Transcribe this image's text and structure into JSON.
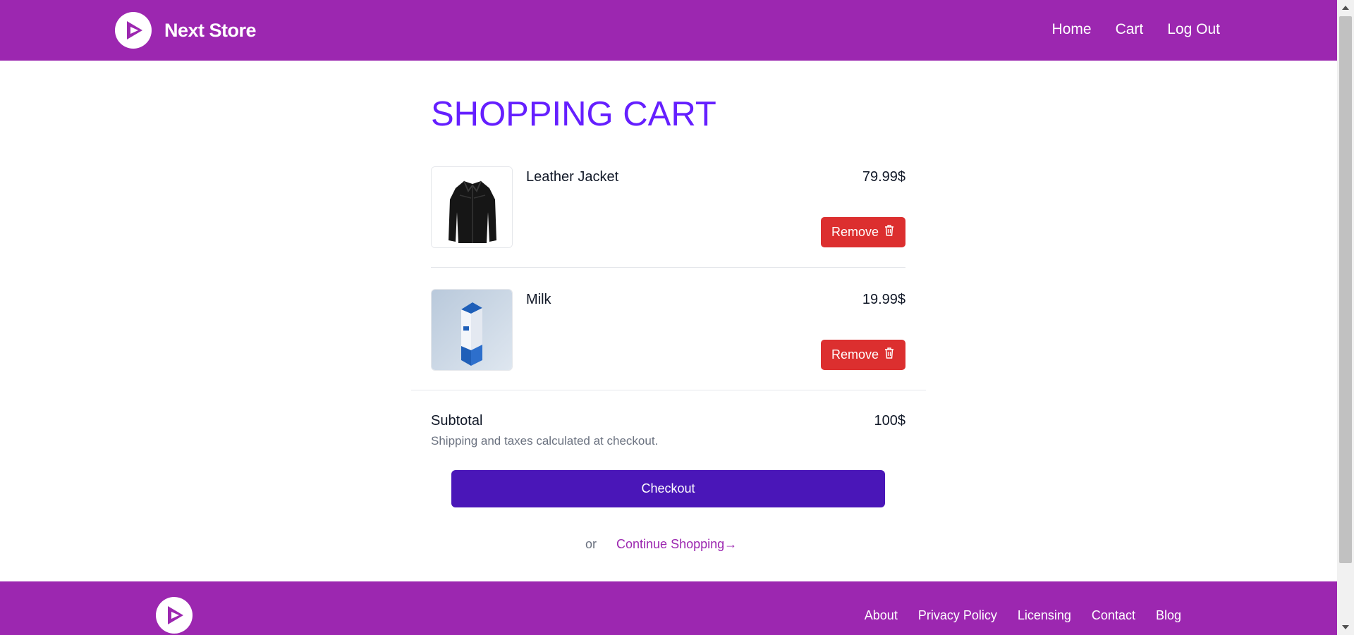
{
  "header": {
    "brand_name": "Next Store",
    "nav": [
      "Home",
      "Cart",
      "Log Out"
    ]
  },
  "page": {
    "title": "SHOPPING CART"
  },
  "cart": {
    "items": [
      {
        "name": "Leather Jacket",
        "price": "79.99$",
        "remove_label": "Remove",
        "image_icon": "leather-jacket-image"
      },
      {
        "name": "Milk",
        "price": "19.99$",
        "remove_label": "Remove",
        "image_icon": "milk-carton-image"
      }
    ],
    "subtotal_label": "Subtotal",
    "subtotal_value": "100$",
    "shipping_note": "Shipping and taxes calculated at checkout.",
    "checkout_label": "Checkout",
    "or_text": "or",
    "continue_label": "Continue Shopping→"
  },
  "footer": {
    "links": [
      "About",
      "Privacy Policy",
      "Licensing",
      "Contact",
      "Blog"
    ]
  },
  "colors": {
    "brand": "#9c27b0",
    "title": "#651fff",
    "checkout": "#4a16b8",
    "remove": "#dc2f2f"
  }
}
